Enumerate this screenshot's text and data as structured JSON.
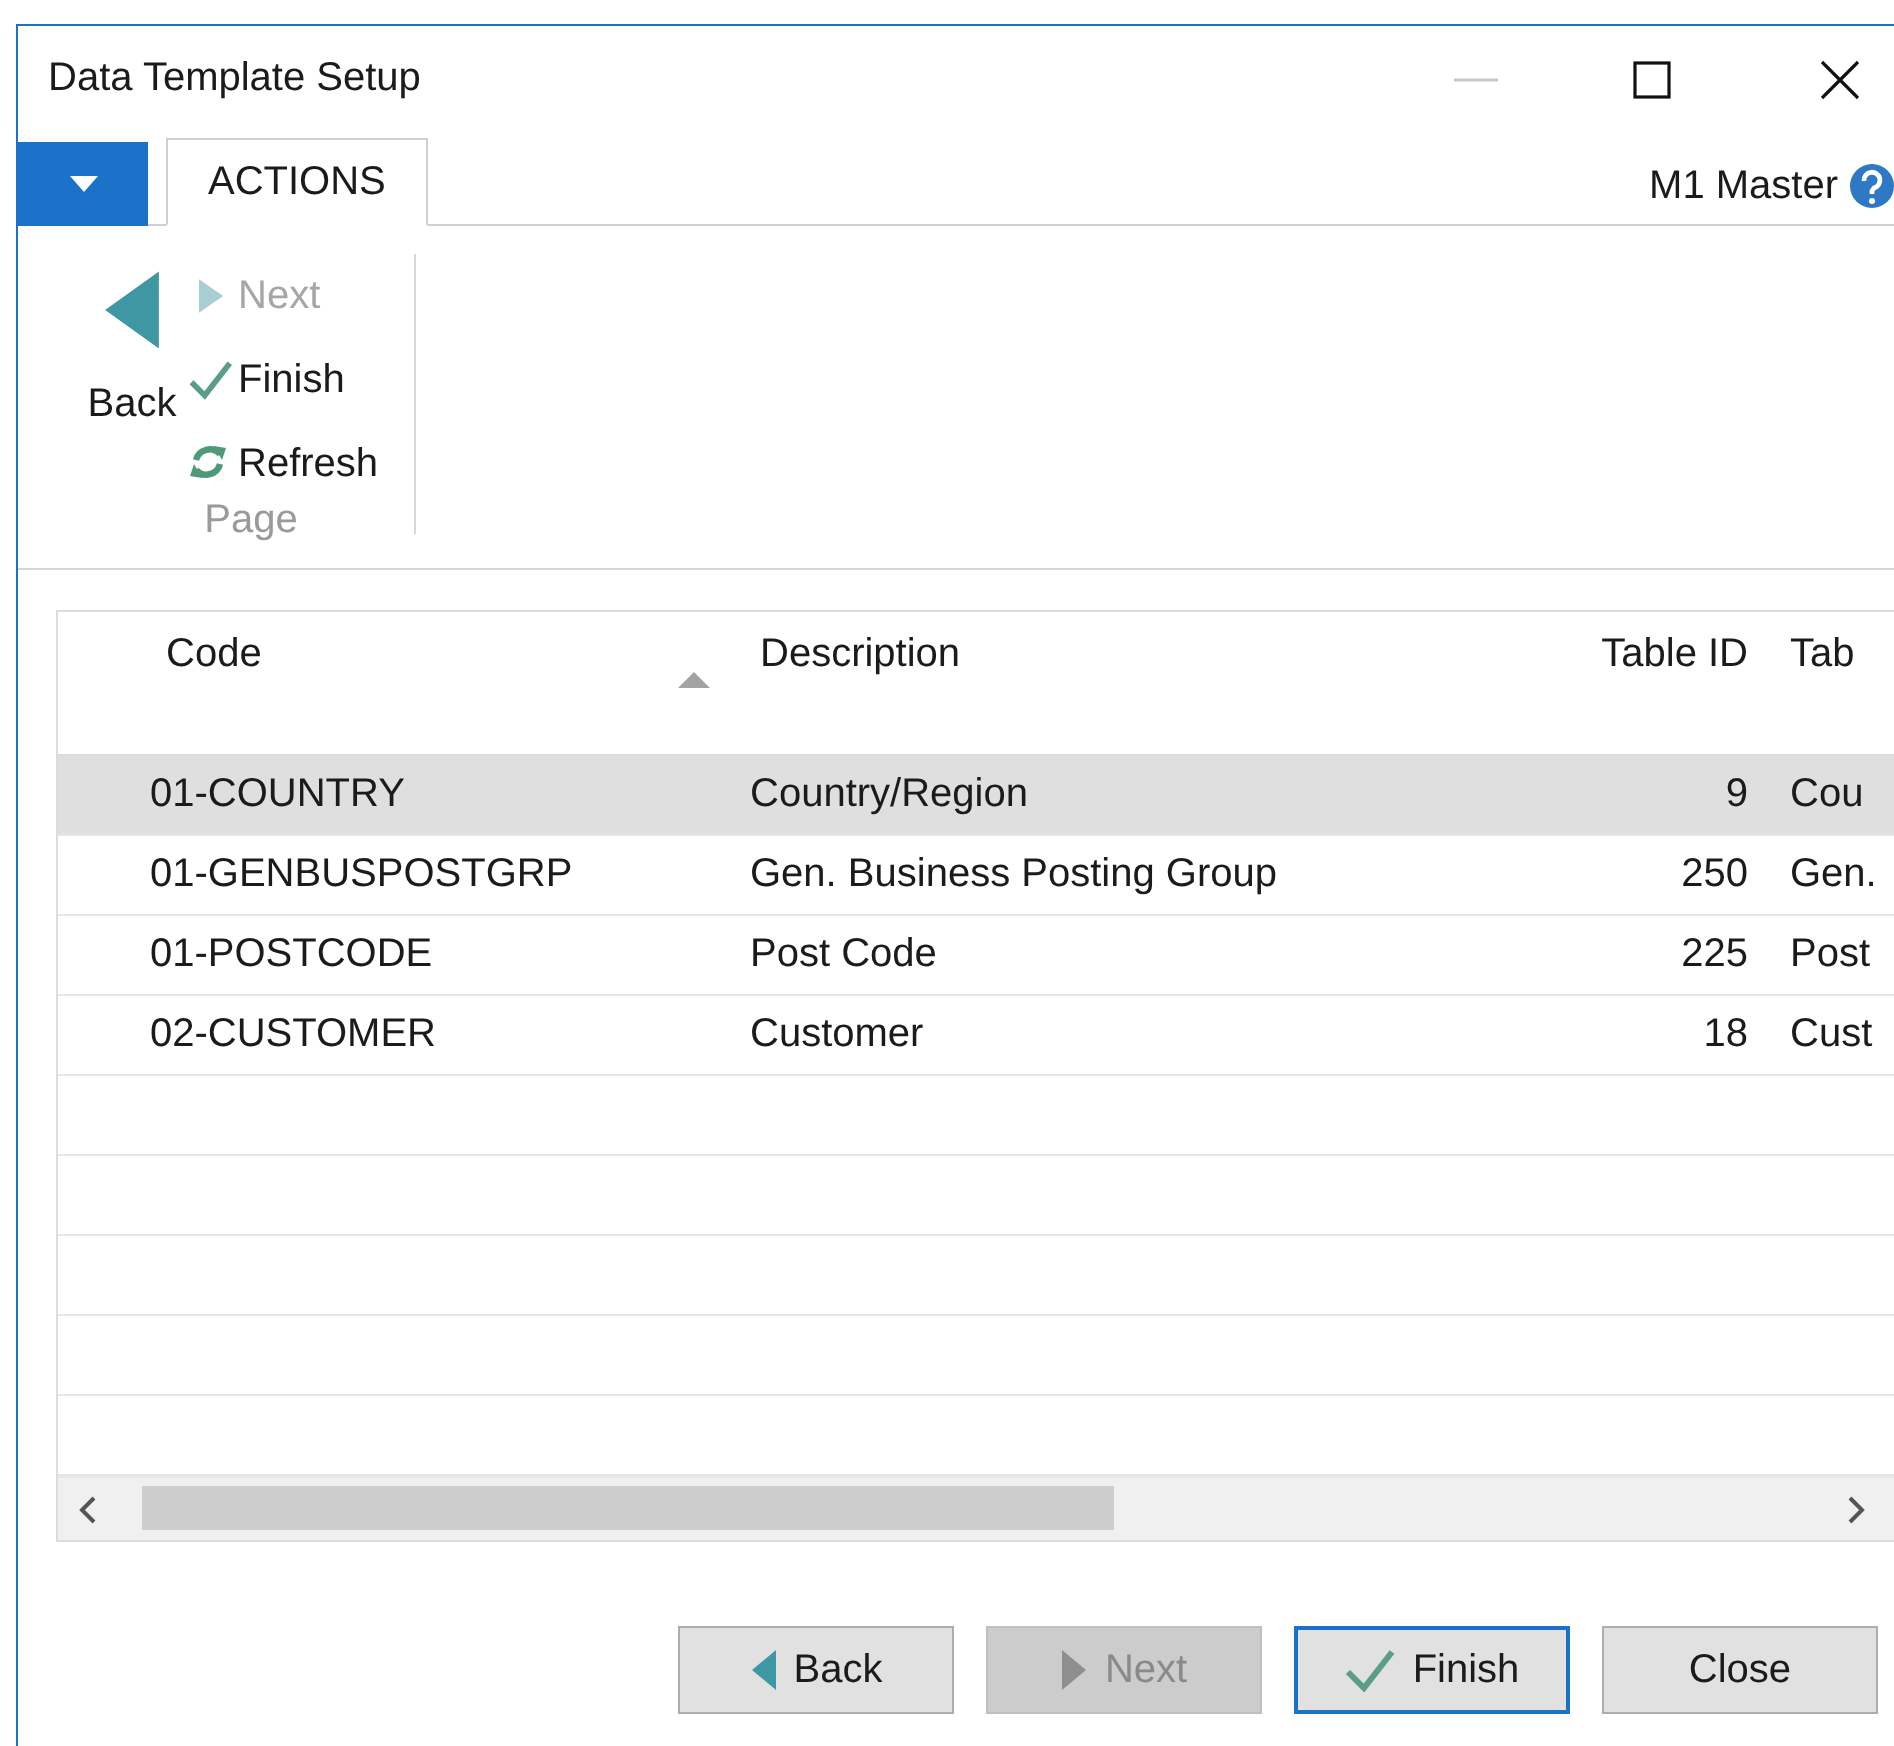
{
  "window": {
    "title": "Data Template Setup"
  },
  "menu_button": {
    "kind": "dropdown"
  },
  "tabs": [
    {
      "label": "ACTIONS",
      "selected": true
    }
  ],
  "company": "M1 Master",
  "ribbon": {
    "large_action": {
      "label": "Back",
      "kind": "back",
      "disabled": false
    },
    "actions": [
      {
        "label": "Next",
        "kind": "next",
        "disabled": true
      },
      {
        "label": "Finish",
        "kind": "finish",
        "disabled": false
      },
      {
        "label": "Refresh",
        "kind": "refresh",
        "disabled": false
      }
    ],
    "group_label": "Page"
  },
  "table": {
    "columns": [
      {
        "label": "Code",
        "kind": "text",
        "sorted": true
      },
      {
        "label": "Description",
        "kind": "text",
        "sorted": false
      },
      {
        "label": "Table ID",
        "kind": "number",
        "sorted": false
      },
      {
        "label": "Tab",
        "kind": "text",
        "sorted": false
      }
    ],
    "rows": [
      {
        "cells": [
          "01-COUNTRY",
          "Country/Region",
          "9",
          "Cou"
        ],
        "selected": true
      },
      {
        "cells": [
          "01-GENBUSPOSTGRP",
          "Gen. Business Posting Group",
          "250",
          "Gen."
        ],
        "selected": false
      },
      {
        "cells": [
          "01-POSTCODE",
          "Post Code",
          "225",
          "Post"
        ],
        "selected": false
      },
      {
        "cells": [
          "02-CUSTOMER",
          "Customer",
          "18",
          "Cust"
        ],
        "selected": false
      }
    ]
  },
  "buttons": [
    {
      "label": "Back",
      "kind": "back",
      "disabled": false,
      "default": false
    },
    {
      "label": "Next",
      "kind": "next",
      "disabled": true,
      "default": false
    },
    {
      "label": "Finish",
      "kind": "finish",
      "disabled": false,
      "default": true
    },
    {
      "label": "Close",
      "kind": "plain",
      "disabled": false,
      "default": false
    }
  ]
}
